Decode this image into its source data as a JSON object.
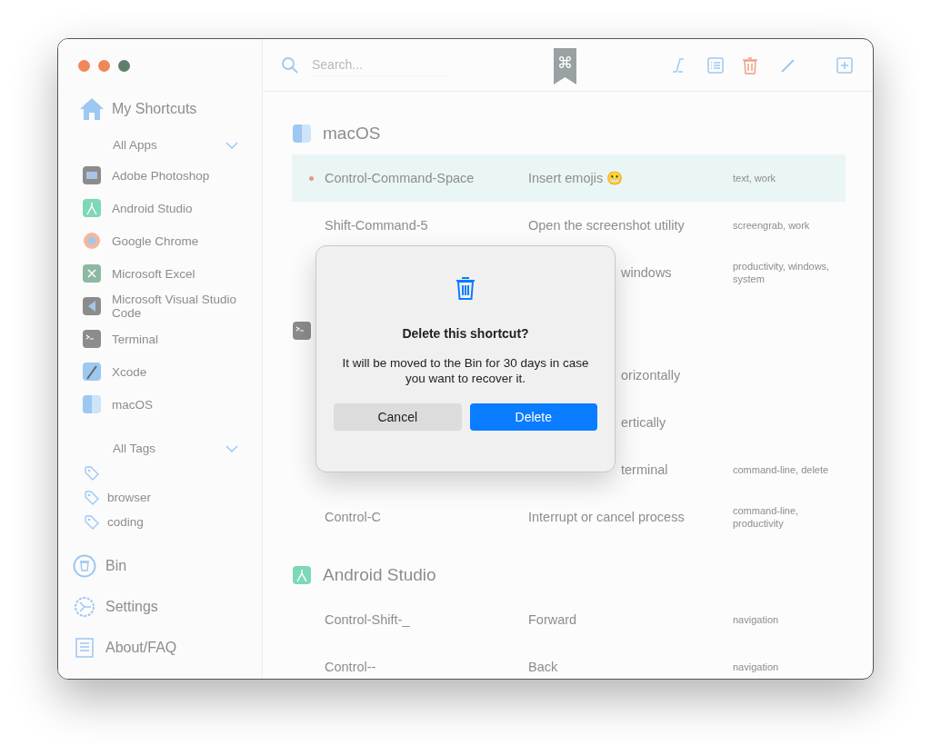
{
  "window": {
    "controls": [
      {
        "color": "#f0875a"
      },
      {
        "color": "#f0875a"
      },
      {
        "color": "#5f7f6c"
      }
    ]
  },
  "sidebar": {
    "home": {
      "label": "My Shortcuts"
    },
    "apps_header": {
      "label": "All Apps",
      "expanded": true
    },
    "apps": [
      {
        "label": "Adobe Photoshop"
      },
      {
        "label": "Android Studio"
      },
      {
        "label": "Google Chrome"
      },
      {
        "label": "Microsoft Excel"
      },
      {
        "label": "Microsoft Visual Studio Code"
      },
      {
        "label": "Terminal"
      },
      {
        "label": "Xcode"
      },
      {
        "label": "macOS"
      }
    ],
    "tags_header": {
      "label": "All Tags",
      "expanded": true
    },
    "tags": [
      {
        "kind": "unnamed"
      },
      {
        "kind": "named",
        "label": "browser"
      },
      {
        "kind": "named",
        "label": "coding"
      }
    ],
    "footer": [
      {
        "label": "Bin"
      },
      {
        "label": "Settings"
      },
      {
        "label": "About/FAQ"
      }
    ]
  },
  "toolbar": {
    "search": {
      "placeholder": "Search..."
    },
    "badge": "⌘"
  },
  "sections": [
    {
      "kind": "titled",
      "title": "macOS",
      "rows": [
        {
          "kind": "full",
          "shortcut": "Control-Command-Space",
          "action": "Insert emojis 😬",
          "tags": "text, work",
          "selected": true,
          "flagged": true
        },
        {
          "kind": "full",
          "shortcut": "Shift-Command-5",
          "action": "Open the screenshot utility",
          "tags": "screengrab, work",
          "selected": false,
          "flagged": false
        },
        {
          "kind": "covered",
          "action": "windows",
          "tags": "productivity, windows, system",
          "selected": false,
          "flagged": false
        }
      ]
    },
    {
      "kind": "covered",
      "rows": [
        {
          "kind": "covered",
          "action": "orizontally",
          "selected": false,
          "flagged": false
        },
        {
          "kind": "covered",
          "action": "ertically",
          "selected": false,
          "flagged": false
        },
        {
          "kind": "covered",
          "action": "terminal",
          "tags": "command-line, delete",
          "selected": false,
          "flagged": false
        },
        {
          "kind": "full",
          "shortcut": "Control-C",
          "action": "Interrupt or cancel process",
          "tags": "command-line, productivity",
          "selected": false,
          "flagged": false
        }
      ]
    },
    {
      "kind": "titled",
      "title": "Android Studio",
      "rows": [
        {
          "kind": "full",
          "shortcut": "Control-Shift-_",
          "action": "Forward",
          "tags": "navigation",
          "selected": false,
          "flagged": false
        },
        {
          "kind": "full",
          "shortcut": "Control--",
          "action": "Back",
          "tags": "navigation",
          "selected": false,
          "flagged": false
        }
      ]
    }
  ],
  "dialog": {
    "title": "Delete this shortcut?",
    "message": "It will be moved to the Bin for 30 days in case you want to recover it.",
    "buttons": [
      {
        "label": "Cancel",
        "kind": "secondary"
      },
      {
        "label": "Delete",
        "kind": "primary"
      }
    ]
  }
}
